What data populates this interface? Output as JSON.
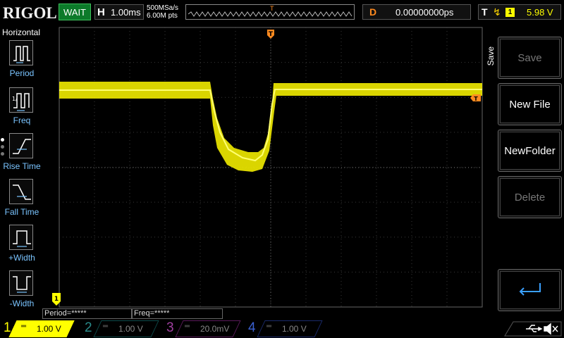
{
  "topbar": {
    "brand": "RIGOL",
    "run_status": "WAIT",
    "timebase_label": "H",
    "timebase_value": "1.00ms",
    "sample_rate": "500MSa/s",
    "memory_depth": "6.00M pts",
    "trigger_marker": "T",
    "delay_label": "D",
    "delay_value": "0.00000000ps",
    "trigger_label": "T",
    "trigger_source": "1",
    "trigger_level": "5.98 V"
  },
  "left_menu": {
    "title": "Horizontal",
    "items": [
      {
        "label": "Period",
        "icon": "period-icon"
      },
      {
        "label": "Freq",
        "icon": "frequency-icon"
      },
      {
        "label": "Rise Time",
        "icon": "rise-time-icon"
      },
      {
        "label": "Fall Time",
        "icon": "fall-time-icon"
      },
      {
        "label": "+Width",
        "icon": "positive-width-icon"
      },
      {
        "label": "-Width",
        "icon": "negative-width-icon"
      }
    ]
  },
  "screen": {
    "trigger_position_marker": "T",
    "ground_marker": "1"
  },
  "measurements": {
    "period": "Period=*****",
    "freq": "Freq=*****"
  },
  "right_menu": {
    "title": "Save",
    "items": [
      {
        "label": "Save",
        "enabled": false
      },
      {
        "label": "New File",
        "enabled": true
      },
      {
        "label": "NewFolder",
        "enabled": true
      },
      {
        "label": "Delete",
        "enabled": false
      },
      {
        "label": "",
        "icon": "enter-icon",
        "enabled": true
      }
    ]
  },
  "channels": [
    {
      "number": "1",
      "scale": "1.00 V",
      "color": "#ffff00",
      "active": true
    },
    {
      "number": "2",
      "scale": "1.00 V",
      "color": "#00c0c0",
      "active": false
    },
    {
      "number": "3",
      "scale": "20.0mV",
      "color": "#e040e0",
      "active": false
    },
    {
      "number": "4",
      "scale": "1.00 V",
      "color": "#3070ff",
      "active": false
    }
  ],
  "colors": {
    "ch1_trace": "#ffff00",
    "trigger": "#ff8a1f",
    "menu_label": "#7ac4ff"
  }
}
